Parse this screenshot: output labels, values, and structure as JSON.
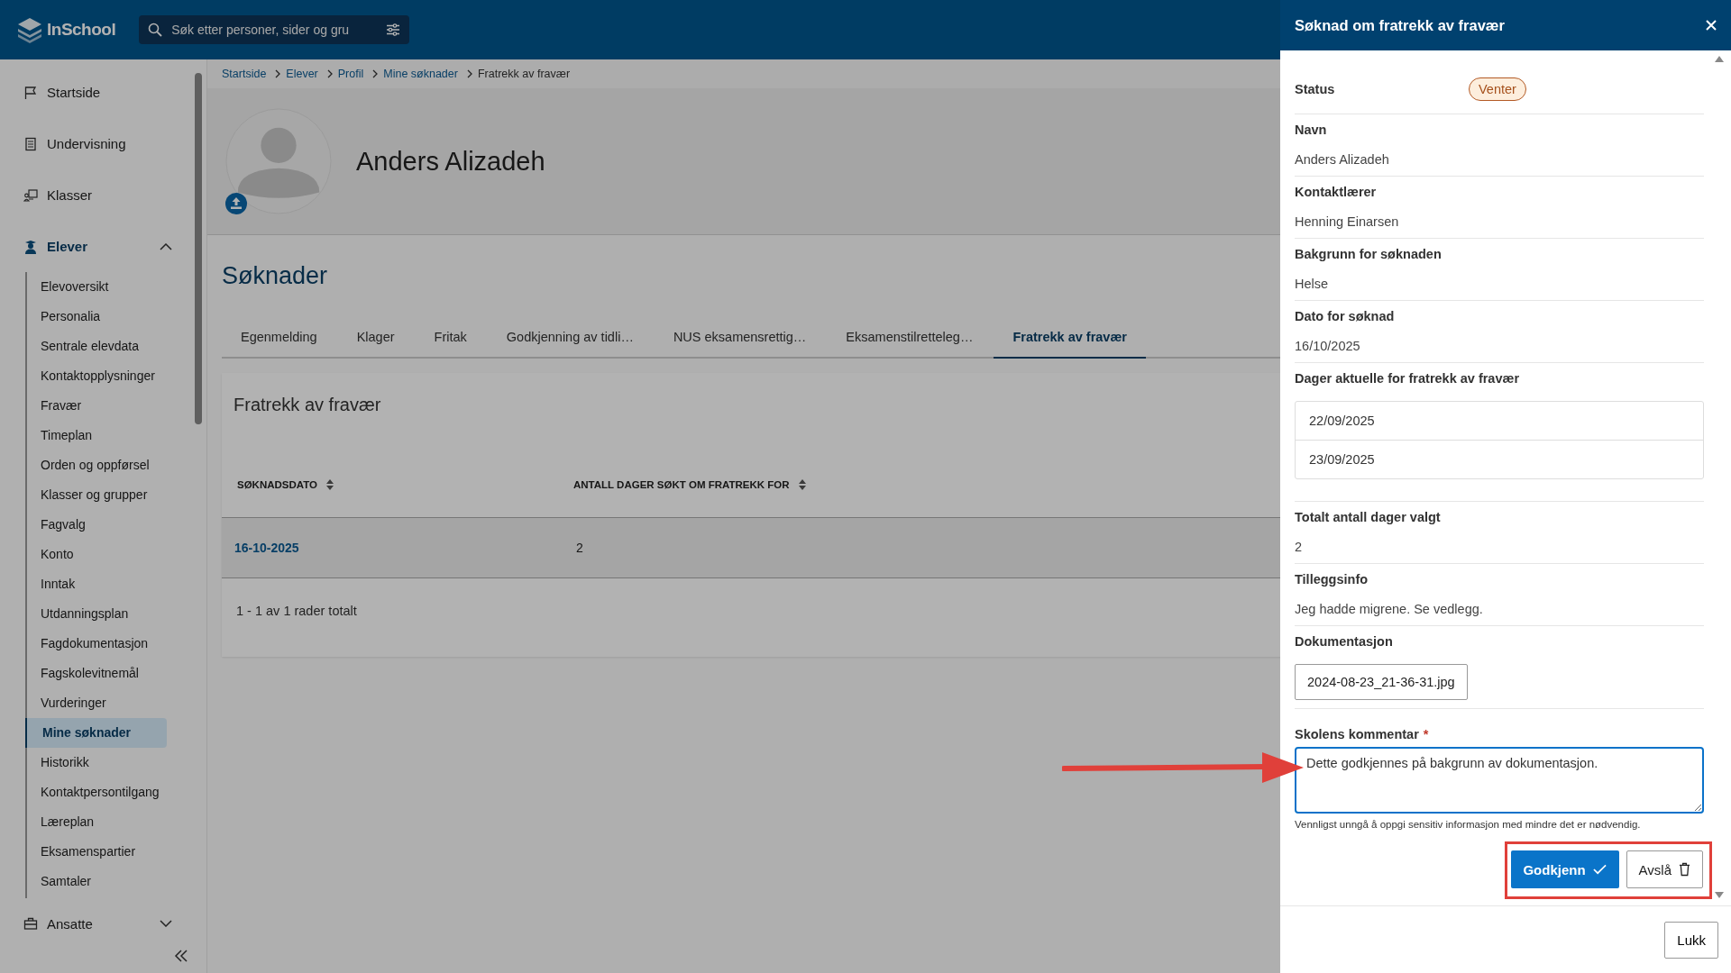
{
  "app": {
    "logo": "InSchool",
    "search": {
      "placeholder": "Søk etter personer, sider og gru"
    }
  },
  "sidebar": {
    "items": [
      {
        "label": "Startside",
        "expanded": false
      },
      {
        "label": "Undervisning",
        "expanded": false
      },
      {
        "label": "Klasser",
        "expanded": false
      },
      {
        "label": "Elever",
        "expanded": true,
        "children": [
          {
            "label": "Elevoversikt",
            "selected": false
          },
          {
            "label": "Personalia",
            "selected": false
          },
          {
            "label": "Sentrale elevdata",
            "selected": false
          },
          {
            "label": "Kontaktopplysninger",
            "selected": false
          },
          {
            "label": "Fravær",
            "selected": false
          },
          {
            "label": "Timeplan",
            "selected": false
          },
          {
            "label": "Orden og oppførsel",
            "selected": false
          },
          {
            "label": "Klasser og grupper",
            "selected": false
          },
          {
            "label": "Fagvalg",
            "selected": false
          },
          {
            "label": "Konto",
            "selected": false
          },
          {
            "label": "Inntak",
            "selected": false
          },
          {
            "label": "Utdanningsplan",
            "selected": false
          },
          {
            "label": "Fagdokumentasjon",
            "selected": false
          },
          {
            "label": "Fagskolevitnemål",
            "selected": false
          },
          {
            "label": "Vurderinger",
            "selected": false
          },
          {
            "label": "Mine søknader",
            "selected": true
          },
          {
            "label": "Historikk",
            "selected": false
          },
          {
            "label": "Kontaktpersontilgang",
            "selected": false
          },
          {
            "label": "Læreplan",
            "selected": false
          },
          {
            "label": "Eksamenspartier",
            "selected": false
          },
          {
            "label": "Samtaler",
            "selected": false
          }
        ]
      },
      {
        "label": "Ansatte",
        "expanded": false
      }
    ]
  },
  "breadcrumb": [
    "Startside",
    "Elever",
    "Profil",
    "Mine søknader",
    "Fratrekk av fravær"
  ],
  "profile": {
    "name": "Anders Alizadeh"
  },
  "section_title": "Søknader",
  "tabs": [
    {
      "label": "Egenmelding",
      "selected": false
    },
    {
      "label": "Klager",
      "selected": false
    },
    {
      "label": "Fritak",
      "selected": false
    },
    {
      "label": "Godkjenning av tidli…",
      "selected": false
    },
    {
      "label": "NUS eksamensrettig…",
      "selected": false
    },
    {
      "label": "Eksamenstilretteleg…",
      "selected": false
    },
    {
      "label": "Fratrekk av fravær",
      "selected": true
    }
  ],
  "card": {
    "title": "Fratrekk av fravær",
    "table": {
      "columns": [
        "SØKNADSDATO",
        "ANTALL DAGER SØKT OM FRATREKK FOR"
      ],
      "rows": [
        [
          "16-10-2025",
          "2"
        ]
      ]
    },
    "footer": "1 - 1 av 1 rader totalt"
  },
  "panel": {
    "title": "Søknad om fratrekk av fravær",
    "fields": [
      {
        "kind": "status",
        "label": "Status",
        "value": "Venter"
      },
      {
        "kind": "text",
        "label": "Navn",
        "value": "Anders Alizadeh"
      },
      {
        "kind": "text",
        "label": "Kontaktlærer",
        "value": "Henning Einarsen"
      },
      {
        "kind": "text",
        "label": "Bakgrunn for søknaden",
        "value": "Helse"
      },
      {
        "kind": "text",
        "label": "Dato for søknad",
        "value": "16/10/2025"
      },
      {
        "kind": "dates",
        "label": "Dager aktuelle for fratrekk av fravær",
        "values": [
          "22/09/2025",
          "23/09/2025"
        ]
      },
      {
        "kind": "text",
        "label": "Totalt antall dager valgt",
        "value": "2"
      },
      {
        "kind": "text",
        "label": "Tilleggsinfo",
        "value": "Jeg hadde migrene. Se vedlegg."
      },
      {
        "kind": "file",
        "label": "Dokumentasjon",
        "value": "2024-08-23_21-36-31.jpg"
      }
    ],
    "comment": {
      "label": "Skolens kommentar",
      "required": true,
      "required_mark": "*",
      "value": "Dette godkjennes på bakgrunn av dokumentasjon.",
      "hint": "Vennligst unngå å oppgi sensitiv informasjon med mindre det er nødvendig."
    },
    "actions": [
      {
        "kind": "primary",
        "label": "Godkjenn"
      },
      {
        "kind": "secondary",
        "label": "Avslå"
      }
    ],
    "close_label": "Lukk"
  },
  "annotations": {
    "arrow": true,
    "highlight_box": true
  }
}
